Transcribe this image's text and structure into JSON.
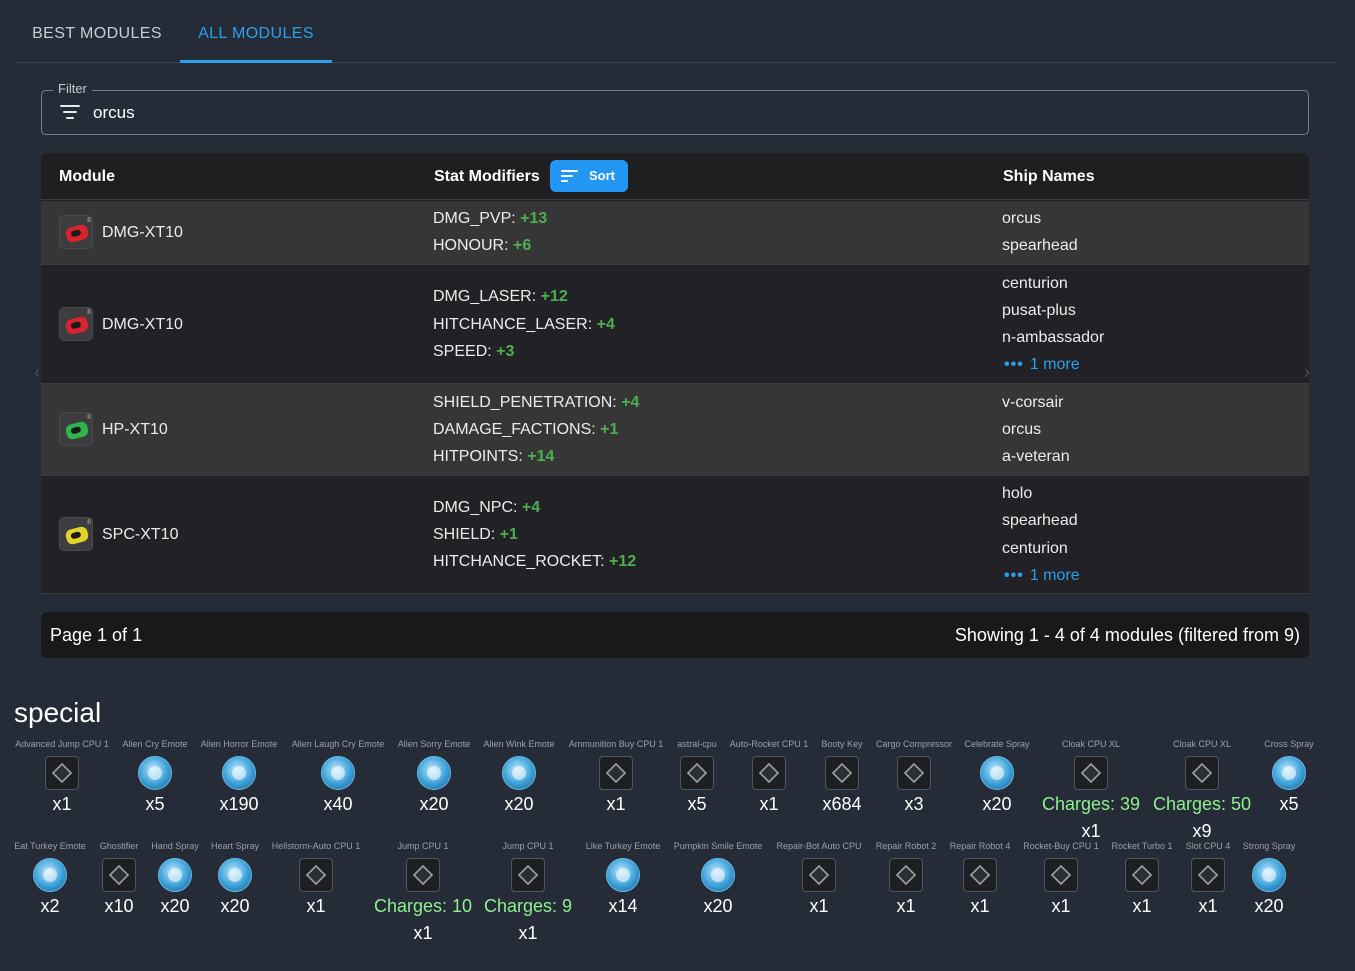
{
  "tabs": [
    {
      "label": "BEST MODULES",
      "active": false
    },
    {
      "label": "ALL MODULES",
      "active": true
    }
  ],
  "filter": {
    "label": "Filter",
    "value": "orcus"
  },
  "table": {
    "headers": {
      "module": "Module",
      "stats": "Stat Modifiers",
      "ships": "Ship Names"
    },
    "sort_label": "Sort",
    "rows": [
      {
        "module": "DMG-XT10",
        "icon": "red-car-module-icon",
        "color": "#d8232e",
        "stats": [
          {
            "name": "DMG_PVP",
            "value": "+13"
          },
          {
            "name": "HONOUR",
            "value": "+6"
          }
        ],
        "ships": [
          "orcus",
          "spearhead"
        ],
        "more": ""
      },
      {
        "module": "DMG-XT10",
        "icon": "red-car-module-icon",
        "color": "#d8232e",
        "stats": [
          {
            "name": "DMG_LASER",
            "value": "+12"
          },
          {
            "name": "HITCHANCE_LASER",
            "value": "+4"
          },
          {
            "name": "SPEED",
            "value": "+3"
          }
        ],
        "ships": [
          "centurion",
          "pusat-plus",
          "n-ambassador"
        ],
        "more": "1 more"
      },
      {
        "module": "HP-XT10",
        "icon": "green-car-module-icon",
        "color": "#2fb54a",
        "stats": [
          {
            "name": "SHIELD_PENETRATION",
            "value": "+4"
          },
          {
            "name": "DAMAGE_FACTIONS",
            "value": "+1"
          },
          {
            "name": "HITPOINTS",
            "value": "+14"
          }
        ],
        "ships": [
          "v-corsair",
          "orcus",
          "a-veteran"
        ],
        "more": ""
      },
      {
        "module": "SPC-XT10",
        "icon": "yellow-car-module-icon",
        "color": "#e2d22a",
        "stats": [
          {
            "name": "DMG_NPC",
            "value": "+4"
          },
          {
            "name": "SHIELD",
            "value": "+1"
          },
          {
            "name": "HITCHANCE_ROCKET",
            "value": "+12"
          }
        ],
        "ships": [
          "holo",
          "spearhead",
          "centurion"
        ],
        "more": "1 more"
      }
    ]
  },
  "pagination": {
    "page": "Page 1 of 1",
    "showing": "Showing 1 - 4 of 4 modules (filtered from 9)"
  },
  "special": {
    "title": "special",
    "row1": [
      {
        "name": "Advanced Jump CPU 1",
        "qty": "x1",
        "charges": "",
        "icon": "cpu-chip-icon"
      },
      {
        "name": "Alien Cry Emote",
        "qty": "x5",
        "charges": "",
        "icon": "alien-emote-icon"
      },
      {
        "name": "Alien Horror Emote",
        "qty": "x190",
        "charges": "",
        "icon": "alien-emote-icon"
      },
      {
        "name": "Alien Laugh Cry Emote",
        "qty": "x40",
        "charges": "",
        "icon": "alien-emote-icon"
      },
      {
        "name": "Alien Sorry Emote",
        "qty": "x20",
        "charges": "",
        "icon": "alien-emote-icon"
      },
      {
        "name": "Alien Wink Emote",
        "qty": "x20",
        "charges": "",
        "icon": "alien-emote-icon"
      },
      {
        "name": "Ammunition Buy CPU 1",
        "qty": "x1",
        "charges": "",
        "icon": "gauge-cpu-icon"
      },
      {
        "name": "astral-cpu",
        "qty": "x5",
        "charges": "",
        "icon": "astral-cpu-icon"
      },
      {
        "name": "Auto-Rocket CPU 1",
        "qty": "x1",
        "charges": "",
        "icon": "rocket-cpu-icon"
      },
      {
        "name": "Booty Key",
        "qty": "x684",
        "charges": "",
        "icon": "key-icon"
      },
      {
        "name": "Cargo Compressor",
        "qty": "x3",
        "charges": "",
        "icon": "compressor-icon"
      },
      {
        "name": "Celebrate Spray",
        "qty": "x20",
        "charges": "",
        "icon": "spray-icon"
      },
      {
        "name": "Cloak CPU XL",
        "qty": "x1",
        "charges": "Charges: 39",
        "icon": "cloak-cpu-icon"
      },
      {
        "name": "Cloak CPU XL",
        "qty": "x9",
        "charges": "Charges: 50",
        "icon": "cloak-cpu-icon"
      },
      {
        "name": "Cross Spray",
        "qty": "x5",
        "charges": "",
        "icon": "spray-icon"
      }
    ],
    "row2": [
      {
        "name": "Eat Turkey Emote",
        "qty": "x2",
        "charges": "",
        "icon": "turkey-emote-icon"
      },
      {
        "name": "Ghostifier",
        "qty": "x10",
        "charges": "",
        "icon": "ghost-icon"
      },
      {
        "name": "Hand Spray",
        "qty": "x20",
        "charges": "",
        "icon": "spray-icon"
      },
      {
        "name": "Heart Spray",
        "qty": "x20",
        "charges": "",
        "icon": "heart-spray-icon"
      },
      {
        "name": "Hellstorm-Auto CPU 1",
        "qty": "x1",
        "charges": "",
        "icon": "hellstorm-cpu-icon"
      },
      {
        "name": "Jump CPU 1",
        "qty": "x1",
        "charges": "Charges: 10",
        "icon": "jump-cpu-icon"
      },
      {
        "name": "Jump CPU 1",
        "qty": "x1",
        "charges": "Charges: 9",
        "icon": "jump-cpu-icon"
      },
      {
        "name": "Like Turkey Emote",
        "qty": "x14",
        "charges": "",
        "icon": "turkey-emote-icon"
      },
      {
        "name": "Pumpkin Smile Emote",
        "qty": "x20",
        "charges": "",
        "icon": "pumpkin-emote-icon"
      },
      {
        "name": "Repair-Bot Auto CPU",
        "qty": "x1",
        "charges": "",
        "icon": "repair-cpu-icon"
      },
      {
        "name": "Repair Robot 2",
        "qty": "x1",
        "charges": "",
        "icon": "repair-robot-icon"
      },
      {
        "name": "Repair Robot 4",
        "qty": "x1",
        "charges": "",
        "icon": "repair-robot-icon"
      },
      {
        "name": "Rocket-Buy CPU 1",
        "qty": "x1",
        "charges": "",
        "icon": "rocket-buy-cpu-icon"
      },
      {
        "name": "Rocket Turbo 1",
        "qty": "x1",
        "charges": "",
        "icon": "rocket-turbo-icon"
      },
      {
        "name": "Slot CPU 4",
        "qty": "x1",
        "charges": "",
        "icon": "slot-cpu-icon"
      },
      {
        "name": "Strong Spray",
        "qty": "x20",
        "charges": "",
        "icon": "spray-icon"
      }
    ]
  },
  "colors": {
    "accent": "#2ba0ea",
    "positive": "#4caf50",
    "charges": "#8ff08f",
    "background": "#262c37"
  }
}
